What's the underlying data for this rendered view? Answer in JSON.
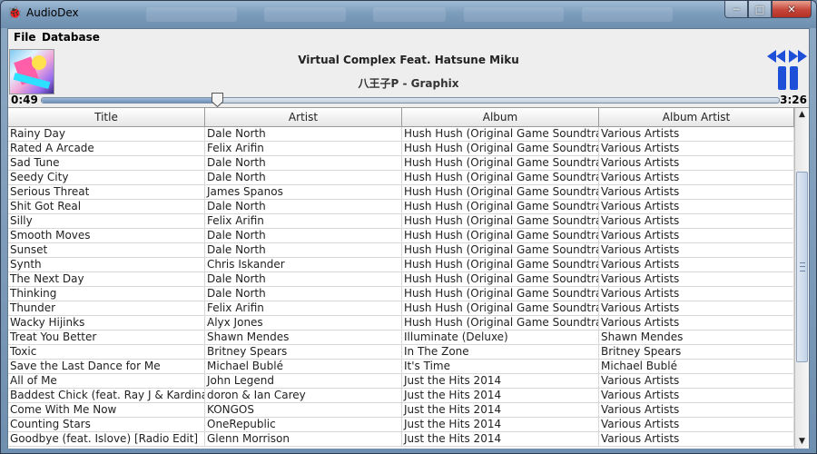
{
  "window": {
    "title": "AudioDex",
    "min_glyph": "─",
    "max_glyph": "□",
    "close_glyph": "✕"
  },
  "menu": {
    "file": "File",
    "database": "Database"
  },
  "player": {
    "song_title": "Virtual Complex Feat. Hatsune Miku",
    "artist_album": "八王子P - Graphix",
    "current_time": "0:49",
    "total_time": "3:26",
    "progress_fraction": 0.238
  },
  "colors": {
    "accent": "#1e4fd8"
  },
  "icons": {
    "app": "audiodex-logo-icon",
    "rewind": "rewind-icon",
    "fast_forward": "fast-forward-icon",
    "pause": "pause-icon"
  },
  "table": {
    "columns": [
      "Title",
      "Artist",
      "Album",
      "Album Artist"
    ],
    "rows": [
      [
        "Rainy Day",
        "Dale North",
        "Hush Hush (Original Game Soundtra...",
        "Various Artists"
      ],
      [
        "Rated A Arcade",
        "Felix Arifin",
        "Hush Hush (Original Game Soundtra...",
        "Various Artists"
      ],
      [
        "Sad Tune",
        "Dale North",
        "Hush Hush (Original Game Soundtra...",
        "Various Artists"
      ],
      [
        "Seedy City",
        "Dale North",
        "Hush Hush (Original Game Soundtra...",
        "Various Artists"
      ],
      [
        "Serious Threat",
        "James Spanos",
        "Hush Hush (Original Game Soundtra...",
        "Various Artists"
      ],
      [
        "Shit Got Real",
        "Dale North",
        "Hush Hush (Original Game Soundtra...",
        "Various Artists"
      ],
      [
        "Silly",
        "Felix Arifin",
        "Hush Hush (Original Game Soundtra...",
        "Various Artists"
      ],
      [
        "Smooth Moves",
        "Dale North",
        "Hush Hush (Original Game Soundtra...",
        "Various Artists"
      ],
      [
        "Sunset",
        "Dale North",
        "Hush Hush (Original Game Soundtra...",
        "Various Artists"
      ],
      [
        "Synth",
        "Chris Iskander",
        "Hush Hush (Original Game Soundtra...",
        "Various Artists"
      ],
      [
        "The Next Day",
        "Dale North",
        "Hush Hush (Original Game Soundtra...",
        "Various Artists"
      ],
      [
        "Thinking",
        "Dale North",
        "Hush Hush (Original Game Soundtra...",
        "Various Artists"
      ],
      [
        "Thunder",
        "Felix Arifin",
        "Hush Hush (Original Game Soundtra...",
        "Various Artists"
      ],
      [
        "Wacky Hijinks",
        "Alyx Jones",
        "Hush Hush (Original Game Soundtra...",
        "Various Artists"
      ],
      [
        "Treat You Better",
        "Shawn Mendes",
        "Illuminate (Deluxe)",
        "Shawn Mendes"
      ],
      [
        "Toxic",
        "Britney Spears",
        "In The Zone",
        "Britney Spears"
      ],
      [
        "Save the Last Dance for Me",
        "Michael Bublé",
        "It's Time",
        "Michael Bublé"
      ],
      [
        "All of Me",
        "John Legend",
        "Just the Hits 2014",
        "Various Artists"
      ],
      [
        "Baddest Chick (feat. Ray J & Kardinal...",
        "doron & Ian Carey",
        "Just the Hits 2014",
        "Various Artists"
      ],
      [
        "Come With Me Now",
        "KONGOS",
        "Just the Hits 2014",
        "Various Artists"
      ],
      [
        "Counting Stars",
        "OneRepublic",
        "Just the Hits 2014",
        "Various Artists"
      ],
      [
        "Goodbye (feat. Islove) [Radio Edit]",
        "Glenn Morrison",
        "Just the Hits 2014",
        "Various Artists"
      ]
    ]
  }
}
